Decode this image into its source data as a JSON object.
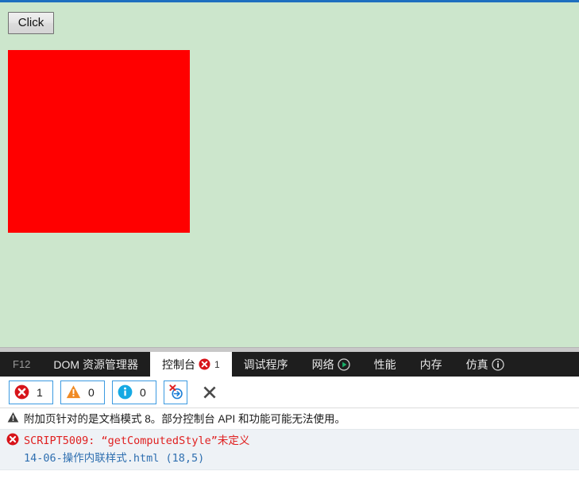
{
  "page": {
    "background_color": "#cce6cc",
    "top_border_color": "#1e6fbf",
    "click_button_label": "Click",
    "red_box_color": "#ff0000"
  },
  "devtools": {
    "tabs": [
      {
        "label": "F12",
        "icon": "",
        "badge": "",
        "active": false
      },
      {
        "label": "DOM 资源管理器",
        "icon": "",
        "badge": "",
        "active": false
      },
      {
        "label": "控制台",
        "icon": "error-icon",
        "badge": "1",
        "active": true
      },
      {
        "label": "调试程序",
        "icon": "",
        "badge": "",
        "active": false
      },
      {
        "label": "网络",
        "icon": "play-icon",
        "badge": "",
        "active": false
      },
      {
        "label": "性能",
        "icon": "",
        "badge": "",
        "active": false
      },
      {
        "label": "内存",
        "icon": "",
        "badge": "",
        "active": false
      },
      {
        "label": "仿真",
        "icon": "info-icon",
        "badge": "",
        "active": false
      }
    ],
    "toolbar": {
      "error_count": "1",
      "warning_count": "0",
      "info_count": "0",
      "clear_on_navigate_icon": "clear-on-navigate-icon",
      "clear_console_icon": "close-x-icon"
    },
    "console_messages": [
      {
        "level": "warning",
        "icon": "warning-triangle-icon",
        "text": "附加页针对的是文档模式 8。部分控制台 API 和功能可能无法使用。",
        "source": ""
      },
      {
        "level": "error",
        "icon": "error-circle-icon",
        "text": "SCRIPT5009: “getComputedStyle”未定义",
        "source": "14-06-操作内联样式.html (18,5)"
      }
    ],
    "colors": {
      "tabstrip_bg": "#1e1e1e",
      "error_red": "#e02020",
      "link_blue": "#2f6fb0",
      "accent_blue": "#3b9ae1",
      "warning_orange": "#f08a24",
      "info_blue": "#00a0e0",
      "network_green": "#16a34a"
    }
  }
}
